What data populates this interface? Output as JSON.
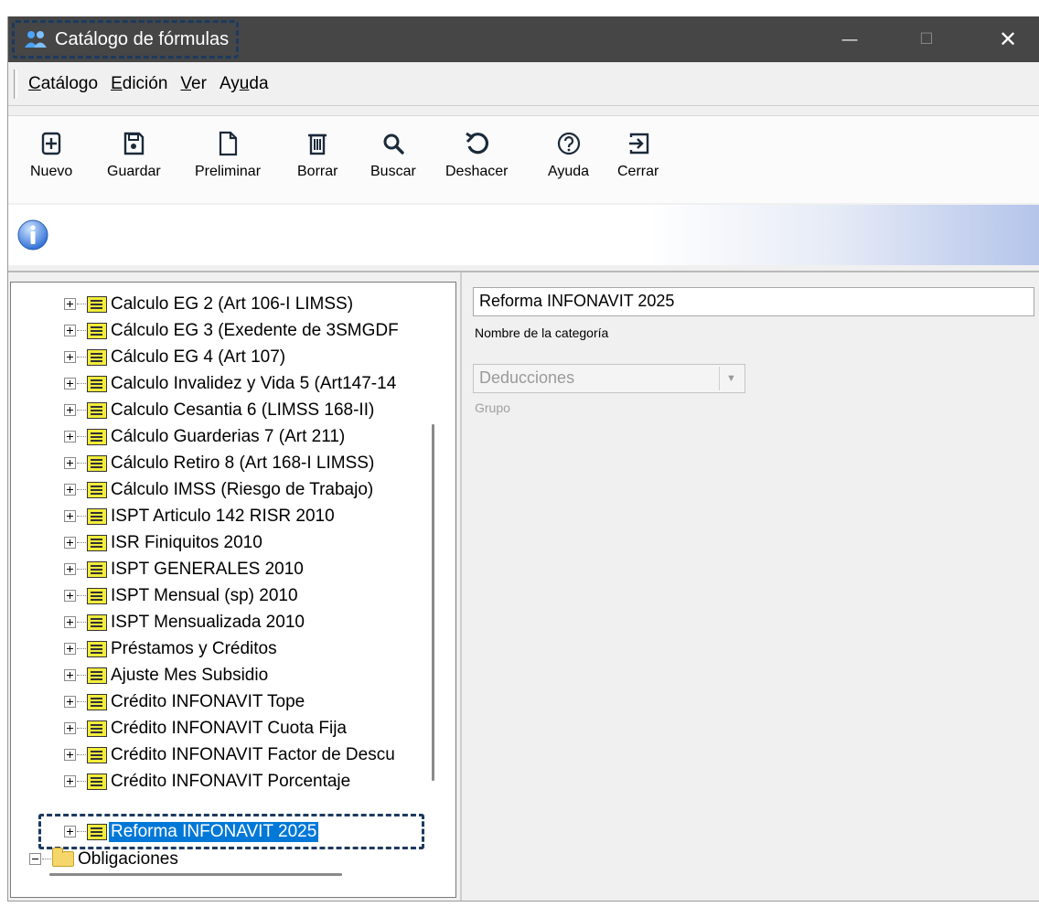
{
  "window": {
    "title": "Catálogo de fórmulas",
    "controls": {
      "minimize": "—",
      "maximize": "☐",
      "close": "✕"
    }
  },
  "menu": [
    {
      "label": "Catálogo",
      "mnemonic": "C",
      "rest": "atálogo"
    },
    {
      "label": "Edición",
      "mnemonic": "E",
      "rest": "dición"
    },
    {
      "label": "Ver",
      "mnemonic": "V",
      "rest": "er"
    },
    {
      "label": "Ayuda",
      "pre": "Ay",
      "mnemonic": "u",
      "rest": "da"
    }
  ],
  "toolbar": [
    {
      "label": "Nuevo",
      "icon": "new-icon"
    },
    {
      "label": "Guardar",
      "icon": "save-icon"
    },
    {
      "label": "Preliminar",
      "icon": "preview-icon"
    },
    {
      "label": "Borrar",
      "icon": "delete-icon"
    },
    {
      "label": "Buscar",
      "icon": "search-icon"
    },
    {
      "label": "Deshacer",
      "icon": "undo-icon"
    },
    {
      "label": "Ayuda",
      "icon": "help-icon"
    },
    {
      "label": "Cerrar",
      "icon": "exit-icon"
    }
  ],
  "info": {
    "icon": "info-icon"
  },
  "tree": {
    "items": [
      "Calculo EG 2 (Art 106-I LIMSS)",
      "Cálculo EG 3 (Exedente de 3SMGDF",
      "Cálculo EG 4 (Art 107)",
      "Calculo Invalidez y Vida 5 (Art147-14",
      "Calculo Cesantia 6 (LIMSS 168-II)",
      "Cálculo Guarderias 7 (Art 211)",
      "Cálculo Retiro 8 (Art 168-I LIMSS)",
      "Cálculo IMSS (Riesgo de Trabajo)",
      "ISPT Articulo 142 RISR 2010",
      "ISR Finiquitos 2010",
      "ISPT GENERALES 2010",
      "ISPT Mensual (sp) 2010",
      "ISPT Mensualizada 2010",
      "Préstamos y Créditos",
      "Ajuste Mes Subsidio",
      "Crédito INFONAVIT Tope",
      "Crédito INFONAVIT Cuota Fija",
      "Crédito INFONAVIT Factor de Descu",
      "Crédito INFONAVIT Porcentaje",
      "Reforma INFONAVIT 2025"
    ],
    "selected": "Reforma INFONAVIT 2025",
    "folder": "Obligaciones"
  },
  "form": {
    "name_value": "Reforma INFONAVIT 2025",
    "name_caption": "Nombre de la categoría",
    "group_value": "Deducciones",
    "group_caption": "Grupo"
  },
  "colors": {
    "titlebar": "#464646",
    "selection": "#0078d7",
    "annotation": "#1c3a60"
  }
}
